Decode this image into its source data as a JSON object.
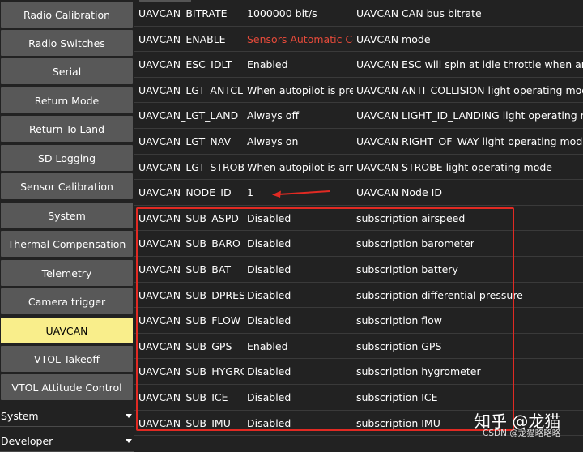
{
  "sidebar": {
    "items": [
      {
        "label": "Radio Calibration",
        "active": false
      },
      {
        "label": "Radio Switches",
        "active": false
      },
      {
        "label": "Serial",
        "active": false
      },
      {
        "label": "Return Mode",
        "active": false
      },
      {
        "label": "Return To Land",
        "active": false
      },
      {
        "label": "SD Logging",
        "active": false
      },
      {
        "label": "Sensor Calibration",
        "active": false
      },
      {
        "label": "System",
        "active": false
      },
      {
        "label": "Thermal Compensation",
        "active": false
      },
      {
        "label": "Telemetry",
        "active": false
      },
      {
        "label": "Camera trigger",
        "active": false
      },
      {
        "label": "UAVCAN",
        "active": true
      },
      {
        "label": "VTOL Takeoff",
        "active": false
      },
      {
        "label": "VTOL Attitude Control",
        "active": false
      }
    ],
    "dropdowns": [
      {
        "label": "System"
      },
      {
        "label": "Developer"
      }
    ]
  },
  "params": [
    {
      "name": "UAVCAN_BITRATE",
      "value": "1000000 bit/s",
      "desc": "UAVCAN CAN bus bitrate"
    },
    {
      "name": "UAVCAN_ENABLE",
      "value": "Sensors Automatic Config",
      "desc": "UAVCAN mode",
      "modified": true
    },
    {
      "name": "UAVCAN_ESC_IDLT",
      "value": "Enabled",
      "desc": "UAVCAN ESC will spin at idle throttle when armed, even if"
    },
    {
      "name": "UAVCAN_LGT_ANTCL",
      "value": "When autopilot is prearmed",
      "desc": "UAVCAN ANTI_COLLISION light operating mode"
    },
    {
      "name": "UAVCAN_LGT_LAND",
      "value": "Always off",
      "desc": "UAVCAN LIGHT_ID_LANDING light operating mode"
    },
    {
      "name": "UAVCAN_LGT_NAV",
      "value": "Always on",
      "desc": "UAVCAN RIGHT_OF_WAY light operating mode"
    },
    {
      "name": "UAVCAN_LGT_STROB",
      "value": "When autopilot is armed",
      "desc": "UAVCAN STROBE light operating mode"
    },
    {
      "name": "UAVCAN_NODE_ID",
      "value": "1",
      "desc": "UAVCAN Node ID"
    },
    {
      "name": "UAVCAN_SUB_ASPD",
      "value": "Disabled",
      "desc": "subscription airspeed"
    },
    {
      "name": "UAVCAN_SUB_BARO",
      "value": "Disabled",
      "desc": "subscription barometer"
    },
    {
      "name": "UAVCAN_SUB_BAT",
      "value": "Disabled",
      "desc": "subscription battery"
    },
    {
      "name": "UAVCAN_SUB_DPRES",
      "value": "Disabled",
      "desc": "subscription differential pressure"
    },
    {
      "name": "UAVCAN_SUB_FLOW",
      "value": "Disabled",
      "desc": "subscription flow"
    },
    {
      "name": "UAVCAN_SUB_GPS",
      "value": "Enabled",
      "desc": "subscription GPS"
    },
    {
      "name": "UAVCAN_SUB_HYGRO",
      "value": "Disabled",
      "desc": "subscription hygrometer"
    },
    {
      "name": "UAVCAN_SUB_ICE",
      "value": "Disabled",
      "desc": "subscription ICE"
    },
    {
      "name": "UAVCAN_SUB_IMU",
      "value": "Disabled",
      "desc": "subscription IMU"
    }
  ],
  "colors": {
    "background": "#222222",
    "button": "#585858",
    "active_button": "#f9ee8b",
    "modified_value": "#e54a3a",
    "annotation": "#e12a23"
  },
  "watermark": {
    "main": "知乎 @龙猫",
    "sub": "CSDN @龙猫略略略"
  }
}
